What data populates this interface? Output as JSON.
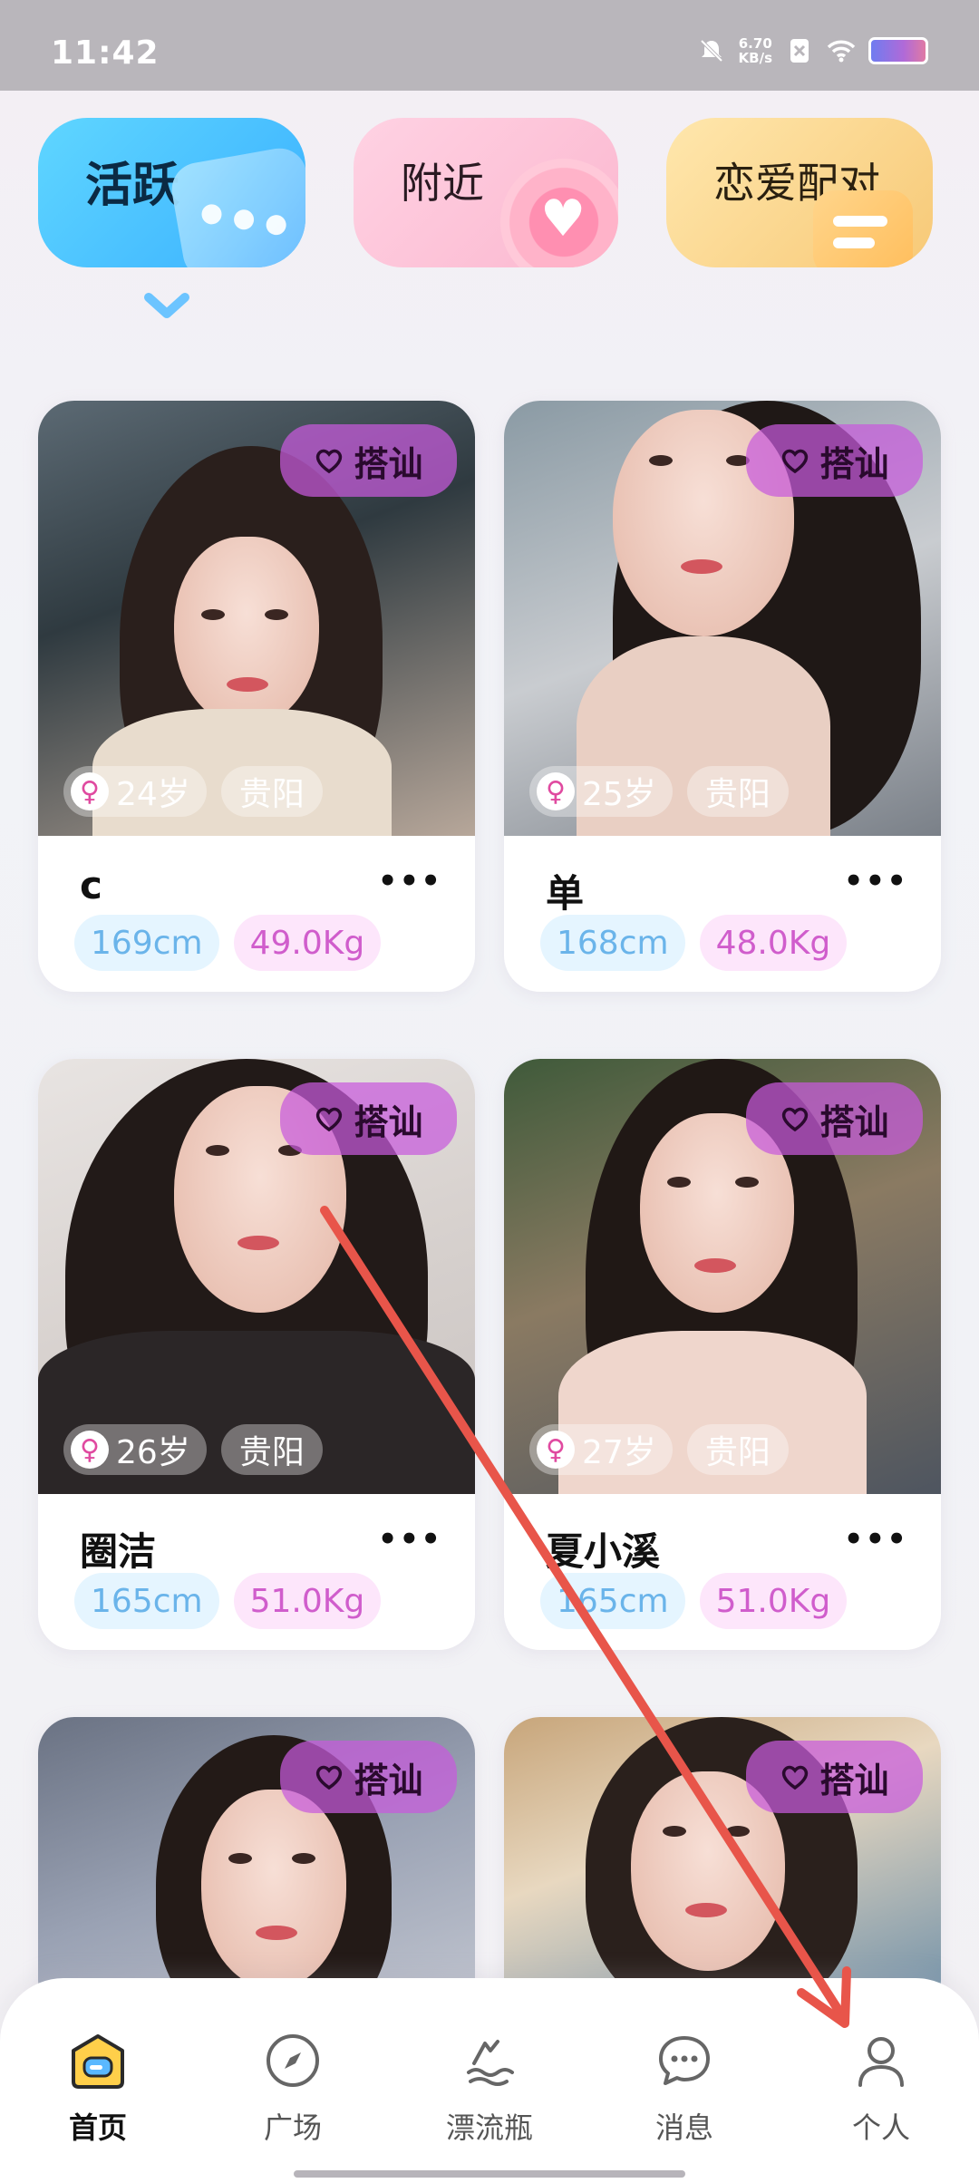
{
  "status_bar": {
    "time": "11:42",
    "speed_value": "6.70",
    "speed_unit": "KB/s"
  },
  "categories": [
    {
      "label": "活跃",
      "active": true
    },
    {
      "label": "附近",
      "active": false
    },
    {
      "label": "恋爱配对",
      "active": false
    }
  ],
  "greet_label": "搭讪",
  "cards": [
    {
      "name": "c",
      "age": "24岁",
      "city": "贵阳",
      "height": "169cm",
      "weight": "49.0Kg"
    },
    {
      "name": "单",
      "age": "25岁",
      "city": "贵阳",
      "height": "168cm",
      "weight": "48.0Kg"
    },
    {
      "name": "圈洁",
      "age": "26岁",
      "city": "贵阳",
      "height": "165cm",
      "weight": "51.0Kg"
    },
    {
      "name": "夏小溪",
      "age": "27岁",
      "city": "贵阳",
      "height": "165cm",
      "weight": "51.0Kg"
    }
  ],
  "bottom_nav": [
    {
      "label": "首页",
      "icon": "home-icon",
      "active": true
    },
    {
      "label": "广场",
      "icon": "compass-icon",
      "active": false
    },
    {
      "label": "漂流瓶",
      "icon": "wave-icon",
      "active": false
    },
    {
      "label": "消息",
      "icon": "message-icon",
      "active": false
    },
    {
      "label": "个人",
      "icon": "person-icon",
      "active": false
    }
  ],
  "colors": {
    "accent_blue": "#3ab0ff",
    "greet_purple": "#c85adc",
    "annotation_red": "#e8554a"
  }
}
